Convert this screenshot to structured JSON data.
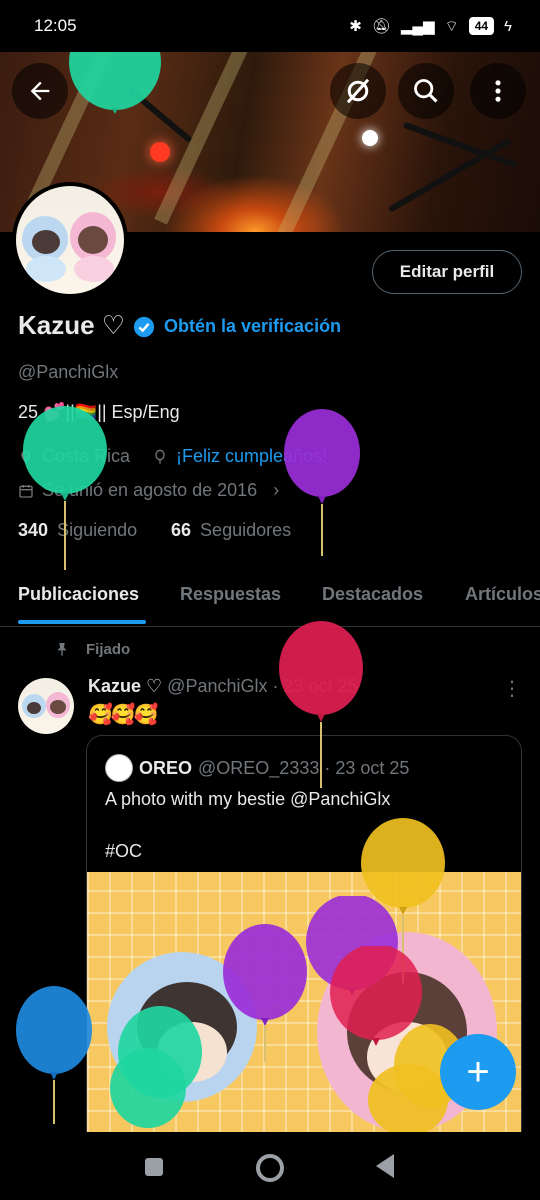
{
  "status_bar": {
    "time": "12:05",
    "battery": "44"
  },
  "header": {
    "back_icon": "arrow-left-icon",
    "grok_icon": "grok-icon",
    "search_icon": "search-icon",
    "more_icon": "more-vertical-icon"
  },
  "profile": {
    "edit_label": "Editar perfil",
    "name": "Kazue ♡",
    "verify_label": "Obtén la verificación",
    "handle": "@PanchiGlx",
    "bio": "25 💕||🏳️‍🌈|| Esp/Eng",
    "location": "Costa Rica",
    "birthday": "¡Feliz cumpleaños!",
    "joined": "Se unió en agosto de 2016",
    "following_count": "340",
    "following_label": "Siguiendo",
    "followers_count": "66",
    "followers_label": "Seguidores"
  },
  "tabs": [
    "Publicaciones",
    "Respuestas",
    "Destacados",
    "Artículos"
  ],
  "post": {
    "pinned_label": "Fijado",
    "author": "Kazue ♡",
    "handle_date": "@PanchiGlx · 23 oct 25",
    "text": "🥰🥰🥰",
    "quote": {
      "author": "OREO",
      "handle_date": "@OREO_2333 · 23 oct 25",
      "text": "A photo with my bestie @PanchiGlx",
      "hashtag": "#OC"
    }
  },
  "fab_label": "+",
  "colors": {
    "accent": "#1d9bf0",
    "muted": "#71767b",
    "text": "#e7e9ea",
    "border": "#2f3336"
  }
}
